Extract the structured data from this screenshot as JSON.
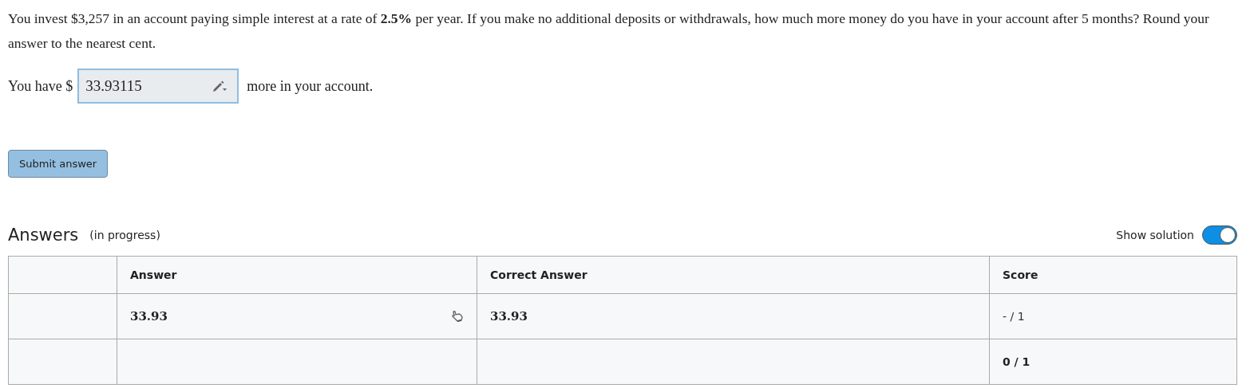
{
  "question": "You invest $3,257 in an account paying simple interest at a rate of **2.5%** per year. If you make no additional deposits or withdrawals, how much more money do you have in your account after 5 months? Round your answer to the nearest cent.",
  "answer_line": {
    "prefix": "You have $",
    "value": "33.93115",
    "suffix": "more in your account."
  },
  "submit_button": "Submit answer",
  "answers": {
    "title": "Answers",
    "status": "(in progress)",
    "show_solution": {
      "label": "Show solution",
      "on": true
    },
    "columns": [
      "Answer",
      "Correct Answer",
      "Score"
    ],
    "rows": [
      {
        "answer": "33.93",
        "correct_answer": "33.93",
        "score": "- / 1"
      }
    ],
    "total": {
      "score": "0 / 1"
    }
  }
}
